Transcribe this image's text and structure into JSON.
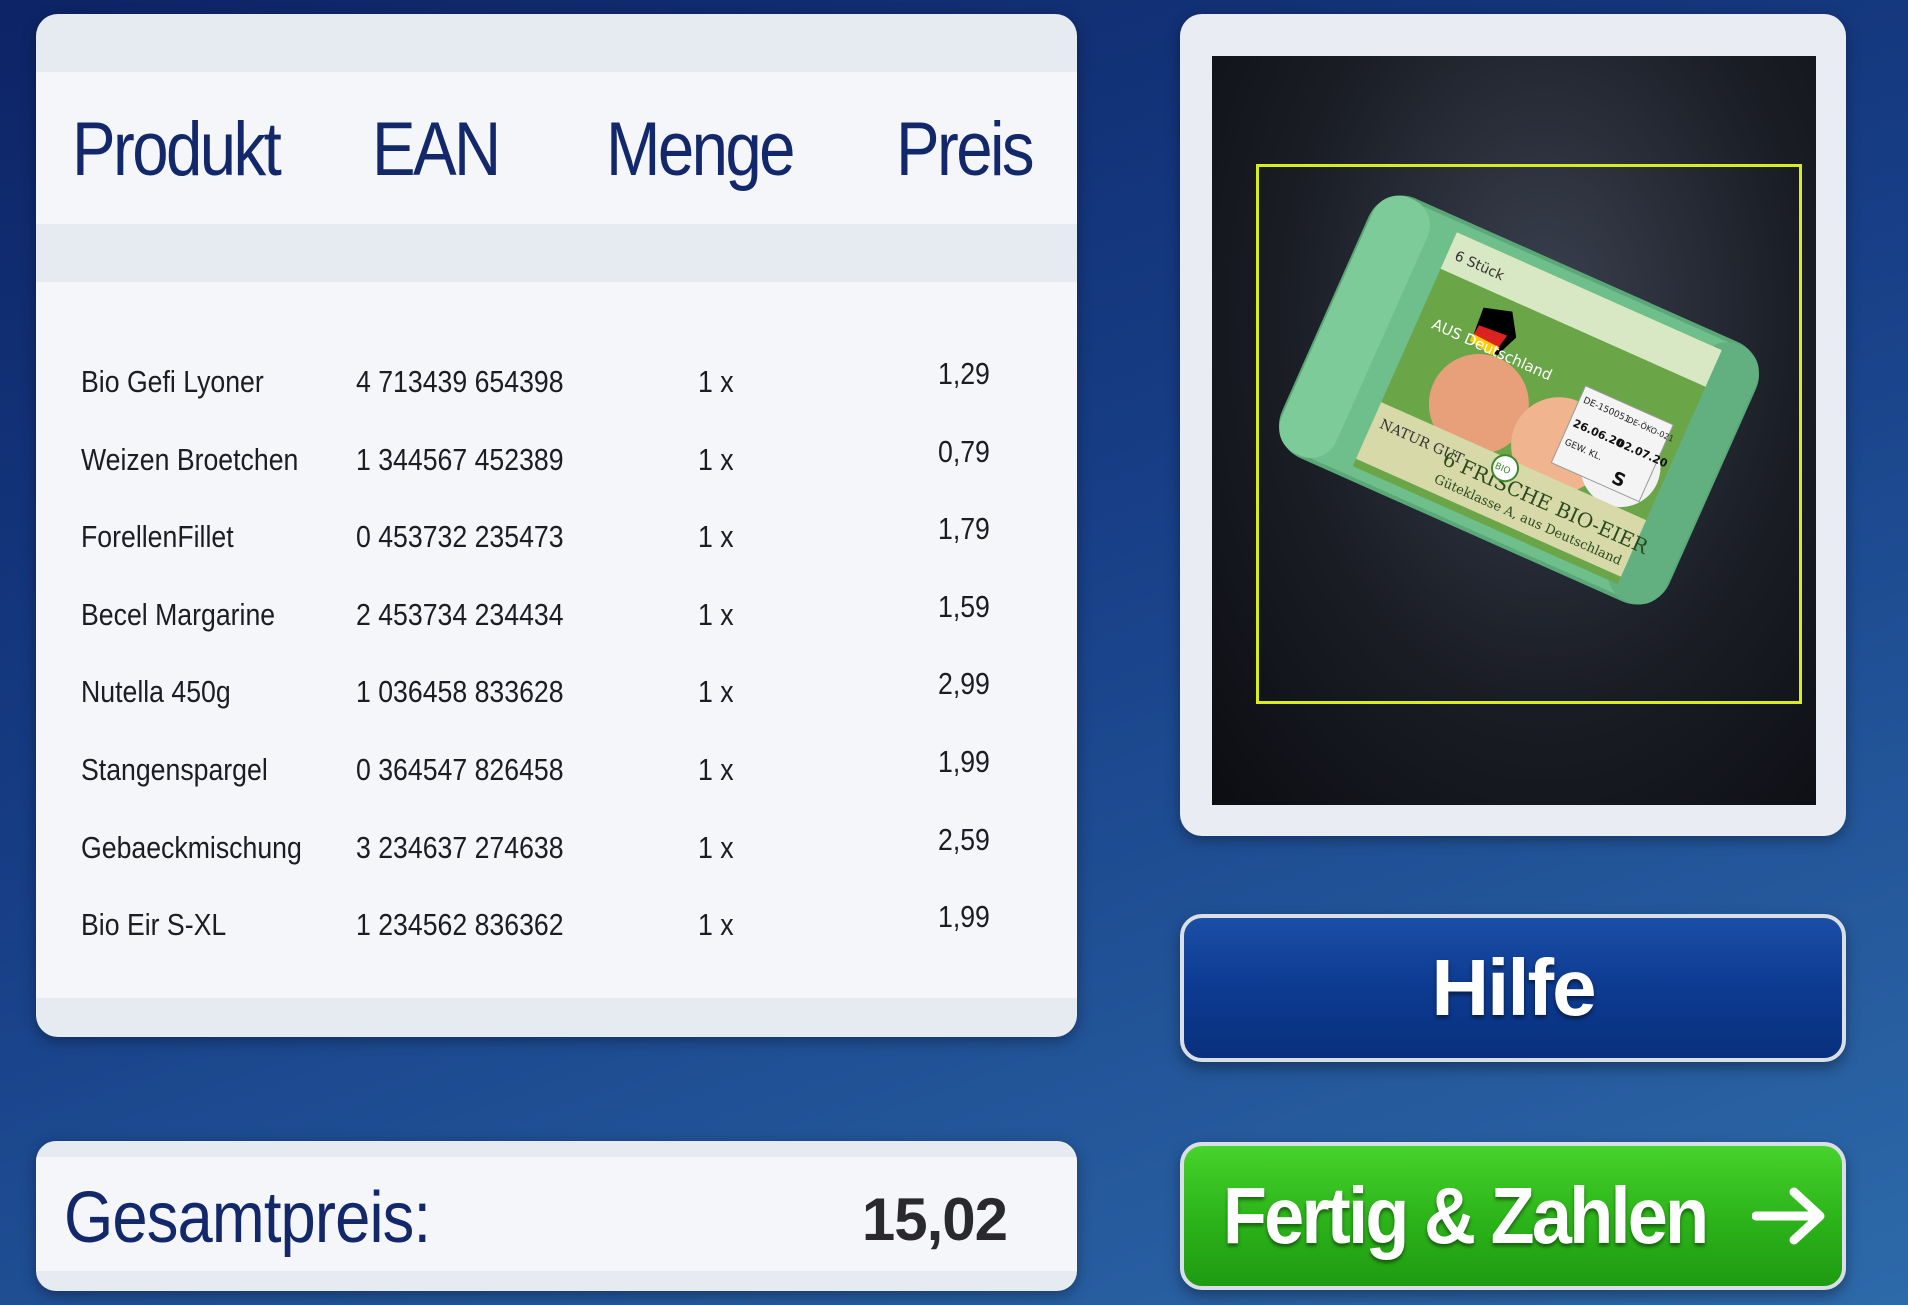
{
  "table": {
    "headers": {
      "product": "Produkt",
      "ean": "EAN",
      "quantity": "Menge",
      "price": "Preis"
    },
    "rows": [
      {
        "name": "Bio Gefi Lyoner",
        "ean": "4 713439 654398",
        "qty": "1 x",
        "price": "1,29"
      },
      {
        "name": "Weizen Broetchen",
        "ean": "1 344567 452389",
        "qty": "1 x",
        "price": "0,79"
      },
      {
        "name": "ForellenFillet",
        "ean": "0 453732 235473",
        "qty": "1 x",
        "price": "1,79"
      },
      {
        "name": "Becel Margarine",
        "ean": "2 453734 234434",
        "qty": "1 x",
        "price": "1,59"
      },
      {
        "name": "Nutella 450g",
        "ean": "1 036458 833628",
        "qty": "1 x",
        "price": "2,99"
      },
      {
        "name": "Stangenspargel",
        "ean": "0 364547 826458",
        "qty": "1 x",
        "price": "1,99"
      },
      {
        "name": "Gebaeckmischung",
        "ean": "3 234637 274638",
        "qty": "1 x",
        "price": "2,59"
      },
      {
        "name": "Bio Eir S-XL",
        "ean": "1 234562 836362",
        "qty": "1 x",
        "price": "1,99"
      }
    ]
  },
  "total": {
    "label": "Gesamtpreis:",
    "value": "15,02"
  },
  "scan": {
    "package_text": {
      "count": "6 Stück",
      "origin": "AUS Deutschland",
      "brand": "NATUR GUT",
      "bio": "BIO",
      "title": "6 FRISCHE BIO-EIER",
      "subtitle": "Güteklasse A, aus Deutschland",
      "code1": "DE-150051",
      "code2": "DE-ÖKO-021",
      "date1": "26.06.20",
      "date2": "02.07.20",
      "weight_class_label": "GEW. KL.",
      "weight_class": "S"
    },
    "frame_color": "#d8ee1c"
  },
  "buttons": {
    "help": "Hilfe",
    "pay": "Fertig & Zahlen",
    "pay_icon": "arrow-right-icon"
  },
  "colors": {
    "header_text": "#13286b",
    "help_button": "#0e3c93",
    "pay_button": "#2db51a"
  }
}
